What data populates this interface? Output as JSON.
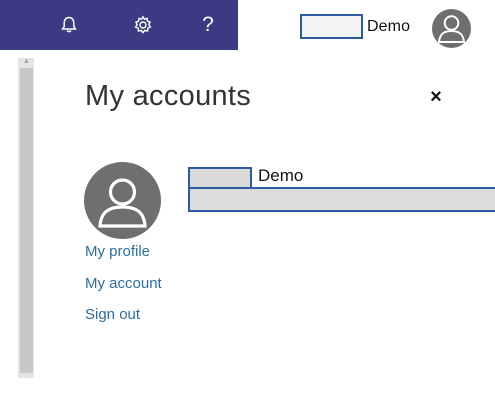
{
  "header": {
    "username": "Demo",
    "icons": {
      "notifications": "bell-icon",
      "settings": "gear-icon",
      "help": "help-icon"
    },
    "help_glyph": "?",
    "accent_color": "#3b3b83"
  },
  "panel": {
    "title": "My accounts",
    "close_glyph": "×",
    "account_name": "Demo",
    "links": {
      "profile": "My profile",
      "account": "My account",
      "sign_out": "Sign out"
    }
  }
}
